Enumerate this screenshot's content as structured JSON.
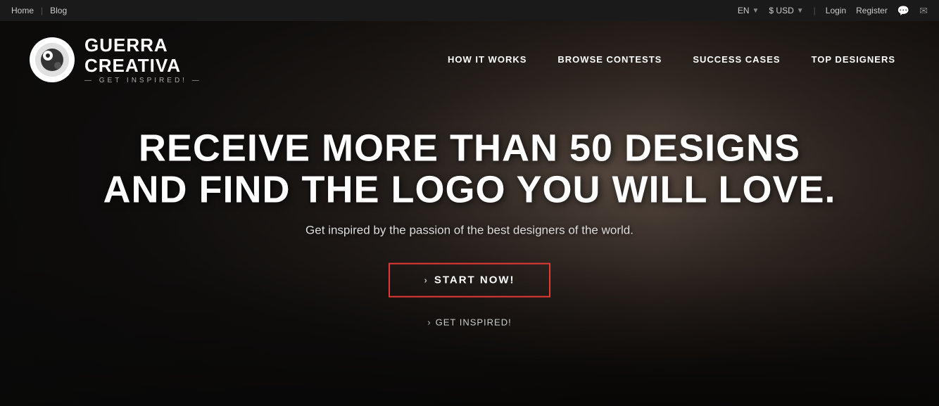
{
  "topbar": {
    "home_label": "Home",
    "blog_label": "Blog",
    "separator": "|",
    "lang_label": "EN",
    "currency_label": "$ USD",
    "login_label": "Login",
    "register_label": "Register"
  },
  "nav": {
    "logo_name_line1": "GUERRA",
    "logo_name_line2": "CREATIVA",
    "logo_tagline": "— GET INSPIRED! —",
    "links": [
      {
        "label": "HOW IT WORKS",
        "id": "how-it-works"
      },
      {
        "label": "BROWSE CONTESTS",
        "id": "browse-contests"
      },
      {
        "label": "SUCCESS CASES",
        "id": "success-cases"
      },
      {
        "label": "TOP DESIGNERS",
        "id": "top-designers"
      }
    ]
  },
  "hero": {
    "title_line1": "RECEIVE MORE THAN 50 DESIGNS",
    "title_line2": "AND FIND THE LOGO YOU WILL LOVE.",
    "subtitle": "Get inspired by the passion of the best designers of the world.",
    "btn_start_label": "START NOW!",
    "btn_inspired_label": "GET INSPIRED!"
  }
}
